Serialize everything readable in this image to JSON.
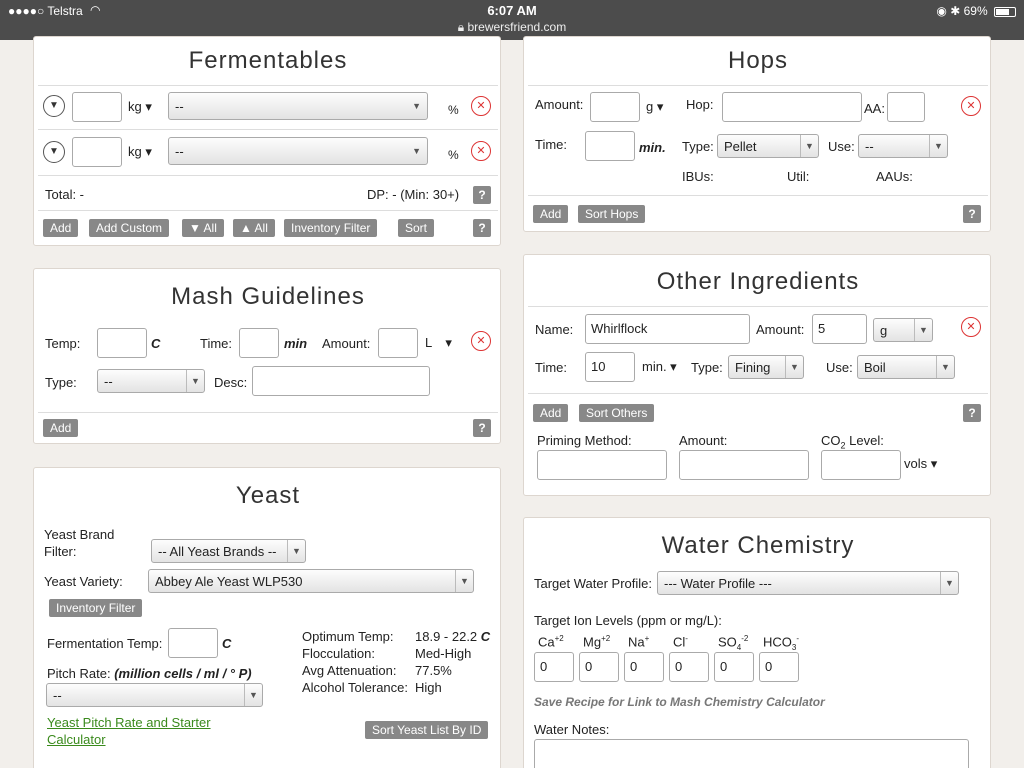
{
  "status": {
    "carrier": "●●●●○ Telstra",
    "time": "6:07 AM",
    "url": "brewersfriend.com",
    "battery": "69%",
    "battery_level": 0.69
  },
  "fermentables": {
    "title": "Fermentables",
    "rows": [
      {
        "unit": "kg ▾",
        "select": "--",
        "pct": "%"
      },
      {
        "unit": "kg ▾",
        "select": "--",
        "pct": "%"
      }
    ],
    "total": "Total: -",
    "dp": "DP: - (Min: 30+)",
    "buttons": [
      "Add",
      "Add Custom",
      "▼ All",
      "▲ All",
      "Inventory Filter",
      "Sort"
    ],
    "help": "?"
  },
  "hops": {
    "title": "Hops",
    "amount_label": "Amount:",
    "amount_unit": "g ▾",
    "hop_label": "Hop:",
    "aa_label": "AA:",
    "time_label": "Time:",
    "time_unit": "min.",
    "type_label": "Type:",
    "type_value": "Pellet",
    "use_label": "Use:",
    "use_value": "--",
    "ibus": "IBUs:",
    "util": "Util:",
    "aaus": "AAUs:",
    "add": "Add",
    "sort": "Sort Hops",
    "help": "?"
  },
  "mash": {
    "title": "Mash Guidelines",
    "temp_label": "Temp:",
    "temp_unit": "C",
    "time_label": "Time:",
    "time_unit": "min",
    "amount_label": "Amount:",
    "amount_unit": "L ▾",
    "type_label": "Type:",
    "type_value": "--",
    "desc_label": "Desc:",
    "add": "Add",
    "help": "?"
  },
  "other": {
    "title": "Other Ingredients",
    "name_label": "Name:",
    "name_value": "Whirlflock",
    "amount_label": "Amount:",
    "amount_value": "5",
    "amount_unit": "g",
    "time_label": "Time:",
    "time_value": "10",
    "time_unit": "min. ▾",
    "type_label": "Type:",
    "type_value": "Fining",
    "use_label": "Use:",
    "use_value": "Boil",
    "add": "Add",
    "sort": "Sort Others",
    "help": "?",
    "priming_label": "Priming Method:",
    "priming_amount_label": "Amount:",
    "co2_label_pre": "CO",
    "co2_label_sub": "2",
    "co2_label_post": " Level:",
    "vols": "vols ▾"
  },
  "yeast": {
    "title": "Yeast",
    "brand_label": "Yeast Brand Filter:",
    "brand_value": "-- All Yeast Brands --",
    "variety_label": "Yeast Variety:",
    "variety_value": "Abbey Ale Yeast WLP530",
    "inventory_filter": "Inventory Filter",
    "ferm_temp_label": "Fermentation Temp:",
    "ferm_temp_unit": "C",
    "pitch_label": "Pitch Rate:",
    "pitch_unit": "(million cells / ml / ° P)",
    "pitch_value": "--",
    "link": "Yeast Pitch Rate and Starter Calculator",
    "opt_temp_label": "Optimum Temp:",
    "opt_temp_value": "18.9 - 22.2",
    "opt_temp_unit": "C",
    "floc_label": "Flocculation:",
    "floc_value": "Med-High",
    "att_label": "Avg Attenuation:",
    "att_value": "77.5%",
    "alc_label": "Alcohol Tolerance:",
    "alc_value": "High",
    "sort_btn": "Sort Yeast List By ID"
  },
  "water": {
    "title": "Water Chemistry",
    "target_label": "Target Water Profile:",
    "target_value": "--- Water Profile ---",
    "ion_label": "Target Ion Levels (ppm or mg/L):",
    "ions": [
      {
        "base": "Ca",
        "sup": "+2",
        "sub": "",
        "value": "0"
      },
      {
        "base": "Mg",
        "sup": "+2",
        "sub": "",
        "value": "0"
      },
      {
        "base": "Na",
        "sup": "+",
        "sub": "",
        "value": "0"
      },
      {
        "base": "Cl",
        "sup": "-",
        "sub": "",
        "value": "0"
      },
      {
        "base": "SO",
        "sub": "4",
        "sup": "-2",
        "value": "0"
      },
      {
        "base": "HCO",
        "sub": "3",
        "sup": "-",
        "value": "0"
      }
    ],
    "save_note": "Save Recipe for Link to Mash Chemistry Calculator",
    "notes_label": "Water Notes:"
  }
}
